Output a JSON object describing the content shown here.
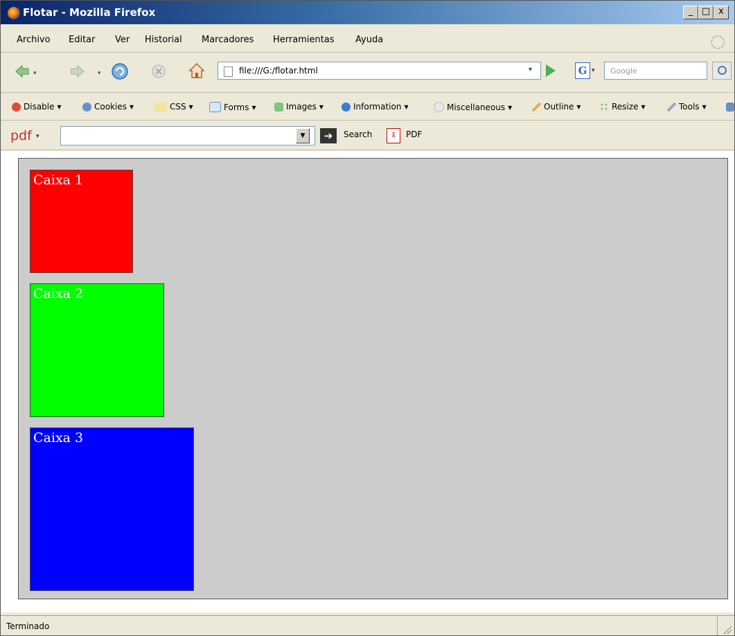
{
  "window": {
    "title": "Flotar - Mozilla Firefox",
    "min_glyph": "_",
    "max_glyph": "□",
    "close_glyph": "x"
  },
  "menu": [
    "Archivo",
    "Editar",
    "Ver",
    "Historial",
    "Marcadores",
    "Herramientas",
    "Ayuda"
  ],
  "nav": {
    "url": "file:///G:/flotar.html",
    "search_placeholder": "Google",
    "search_engine_letter": "G"
  },
  "dev_toolbar": [
    "Disable",
    "Cookies",
    "CSS",
    "Forms",
    "Images",
    "Information",
    "Miscellaneous",
    "Outline",
    "Resize",
    "Tools"
  ],
  "pdf_toolbar": {
    "logo": "pdf",
    "input_value": "",
    "search_label": "Search",
    "pdf_label": "PDF"
  },
  "boxes": [
    {
      "label": "Caixa 1",
      "color": "#ff0000"
    },
    {
      "label": "Caixa 2",
      "color": "#00ff00"
    },
    {
      "label": "Caixa 3",
      "color": "#0000ff"
    }
  ],
  "status": {
    "text": "Terminado"
  },
  "icons": {
    "window": "firefox-icon",
    "back": "back-arrow-icon",
    "forward": "forward-arrow-icon",
    "reload": "reload-icon",
    "stop": "stop-icon",
    "home": "home-icon",
    "go": "go-arrow-icon",
    "search": "magnifier-icon"
  }
}
